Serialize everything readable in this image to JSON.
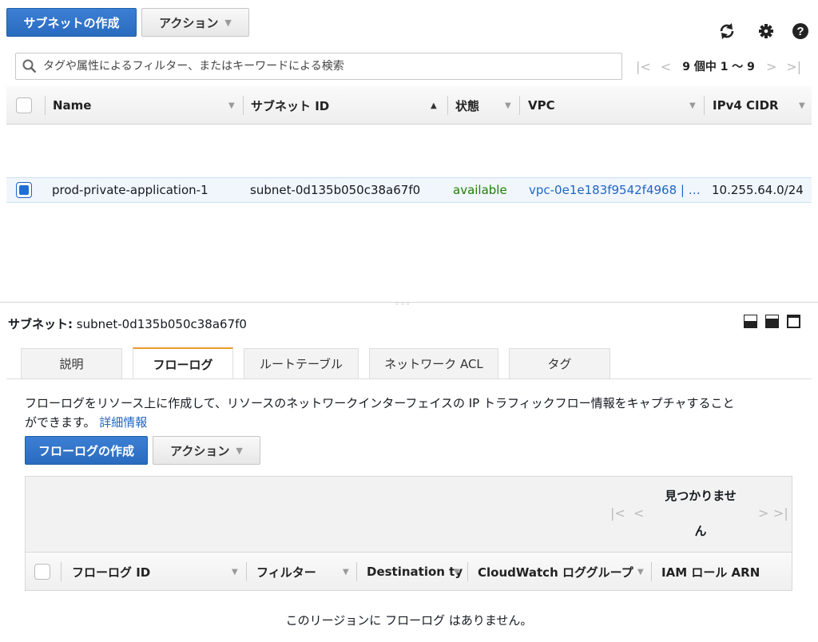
{
  "toolbar": {
    "create_subnet_label": "サブネットの作成",
    "actions_label": "アクション",
    "actions_caret": "▼"
  },
  "search": {
    "placeholder": "タグや属性によるフィルター、またはキーワードによる検索"
  },
  "pagination": {
    "first": "|<",
    "prev": "<",
    "count_text": "9 個中 1 〜 9",
    "next": ">",
    "last": ">|"
  },
  "table": {
    "columns": [
      {
        "label": "Name"
      },
      {
        "label": "サブネット ID"
      },
      {
        "label": "状態"
      },
      {
        "label": "VPC"
      },
      {
        "label": "IPv4 CIDR"
      }
    ],
    "rows": [
      {
        "name": "prod-private-application-1",
        "subnet_id": "subnet-0d135b050c38a67f0",
        "state": "available",
        "vpc": "vpc-0e1e183f9542f4968 | …",
        "ipv4_cidr": "10.255.64.0/24",
        "selected": true
      }
    ]
  },
  "detail": {
    "title_label": "サブネット:",
    "title_value": "subnet-0d135b050c38a67f0",
    "resize_handle": "◦◦◦",
    "tabs": [
      {
        "label": "説明"
      },
      {
        "label": "フローログ"
      },
      {
        "label": "ルートテーブル"
      },
      {
        "label": "ネットワーク ACL"
      },
      {
        "label": "タグ"
      }
    ],
    "description_text": "フローログをリソース上に作成して、リソースのネットワークインターフェイスの IP トラフィックフロー情報をキャプチャすること",
    "description_text_2": "ができます。",
    "learn_more": "詳細情報",
    "create_flowlog_label": "フローログの作成",
    "actions_label": "アクション",
    "pagination_text_1": "見つかりませ",
    "pagination_text_2": "ん",
    "pager_first": "|<",
    "pager_prev": "<",
    "pager_next": ">",
    "pager_last": ">|",
    "columns": [
      {
        "label": "フローログ ID"
      },
      {
        "label": "フィルター"
      },
      {
        "label": "Destination ty"
      },
      {
        "label": "CloudWatch ロググループ"
      },
      {
        "label": "IAM ロール ARN"
      }
    ],
    "empty_message": "このリージョンに フローログ はありません。"
  },
  "colors": {
    "primary": "#2a6bbf",
    "link": "#1f66c2",
    "available": "#1d8102",
    "active_tab": "#ec9a2a"
  },
  "icons": {
    "refresh": "refresh-icon",
    "settings": "gear-icon",
    "help": "help-icon",
    "search": "search-icon"
  }
}
